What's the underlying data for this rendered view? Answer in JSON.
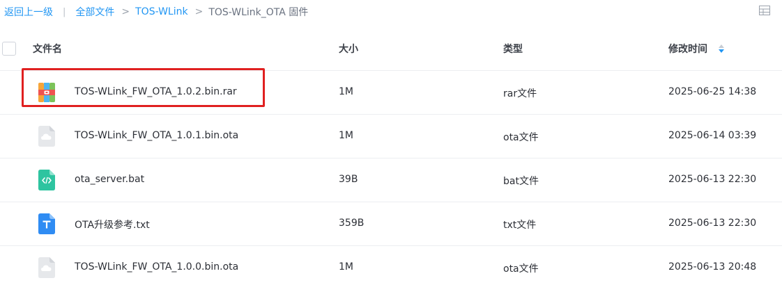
{
  "breadcrumb": {
    "back": "返回上一级",
    "separator": "|",
    "items": [
      "全部文件",
      "TOS-WLink"
    ],
    "current": "TOS-WLink_OTA 固件"
  },
  "table": {
    "headers": {
      "name": "文件名",
      "size": "大小",
      "type": "类型",
      "modified": "修改时间"
    },
    "rows": [
      {
        "name": "TOS-WLink_FW_OTA_1.0.2.bin.rar",
        "size": "1M",
        "type": "rar文件",
        "modified": "2025-06-25 14:38",
        "icon": "rar-archive-icon"
      },
      {
        "name": "TOS-WLink_FW_OTA_1.0.1.bin.ota",
        "size": "1M",
        "type": "ota文件",
        "modified": "2025-06-14 03:39",
        "icon": "cloud-file-icon"
      },
      {
        "name": "ota_server.bat",
        "size": "39B",
        "type": "bat文件",
        "modified": "2025-06-13 22:30",
        "icon": "code-file-icon"
      },
      {
        "name": "OTA升级参考.txt",
        "size": "359B",
        "type": "txt文件",
        "modified": "2025-06-13 22:30",
        "icon": "text-file-icon"
      },
      {
        "name": "TOS-WLink_FW_OTA_1.0.0.bin.ota",
        "size": "1M",
        "type": "ota文件",
        "modified": "2025-06-13 20:48",
        "icon": "cloud-file-icon"
      }
    ]
  },
  "colors": {
    "link": "#2196f3",
    "highlight_border": "#e02020",
    "sort_active": "#2196f3"
  }
}
